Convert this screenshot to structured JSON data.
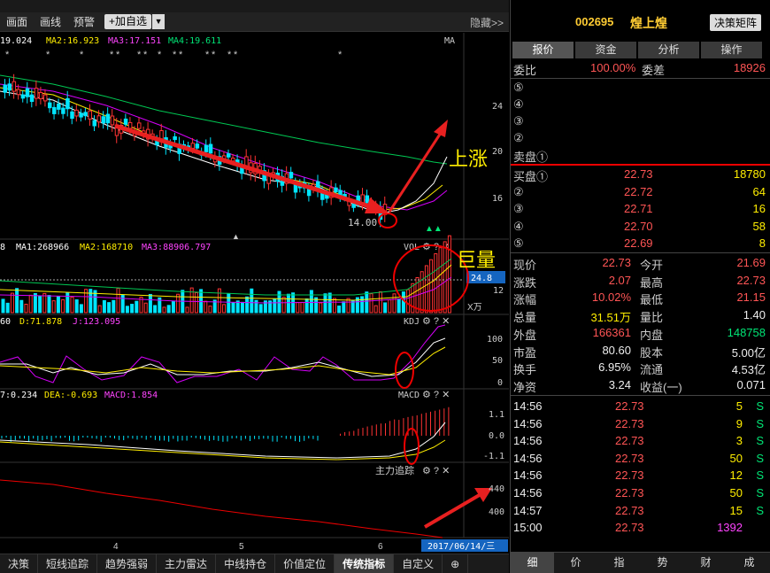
{
  "topbar": {
    "items": [
      "…",
      "…",
      "…",
      "…"
    ]
  },
  "toolbar": {
    "items": [
      "画面",
      "画线",
      "预警"
    ],
    "add_label": "+加自选",
    "hide_label": "隐藏>>"
  },
  "ma_legend": {
    "ma1": "19.024",
    "ma2": "MA2:16.923",
    "ma3": "MA3:17.151",
    "ma4": "MA4:19.611",
    "tag": "MA"
  },
  "vol_legend": {
    "prefix": "8",
    "ma1": "MA1:268966",
    "ma2": "MA2:168710",
    "ma3": "MA3:88906.797",
    "tag": "VOL"
  },
  "kdj_legend": {
    "prefix": "60",
    "d": "D:71.878",
    "j": "J:123.095",
    "tag": "KDJ"
  },
  "macd_legend": {
    "dif": "7:0.234",
    "dea": "DEA:-0.693",
    "macd": "MACD:1.854",
    "tag": "MACD"
  },
  "zljz_tag": "主力追踪",
  "axis": {
    "price": [
      "24",
      "20",
      "16"
    ],
    "vol": [
      "24.8",
      "12",
      "X万"
    ],
    "kdj": [
      "100",
      "50",
      "0"
    ],
    "macd": [
      "1.1",
      "0.0",
      "-1.1"
    ],
    "zljz": [
      "440",
      "400"
    ],
    "months": [
      "4",
      "5",
      "6"
    ],
    "date_label": "2017/06/14/三",
    "low_label": "14.00"
  },
  "annotations": {
    "up": "上涨",
    "vol": "巨量"
  },
  "bottom_tabs": [
    "决策",
    "短线追踪",
    "趋势强弱",
    "主力雷达",
    "中线持仓",
    "价值定位",
    "传统指标",
    "自定义"
  ],
  "active_tab": "传统指标",
  "stock": {
    "code": "002695",
    "name": "煌上煌",
    "matrix_btn": "决策矩阵"
  },
  "rtabs": [
    "报价",
    "资金",
    "分析",
    "操作"
  ],
  "quote": {
    "webi_label": "委比",
    "webi_val": "100.00%",
    "wecha_label": "委差",
    "wecha_val": "18926",
    "sell_levels": [
      "⑤",
      "④",
      "③",
      "②",
      "卖盘①"
    ],
    "buy": [
      {
        "lvl": "买盘①",
        "price": "22.73",
        "vol": "18780"
      },
      {
        "lvl": "②",
        "price": "22.72",
        "vol": "64"
      },
      {
        "lvl": "③",
        "price": "22.71",
        "vol": "16"
      },
      {
        "lvl": "④",
        "price": "22.70",
        "vol": "58"
      },
      {
        "lvl": "⑤",
        "price": "22.69",
        "vol": "8"
      }
    ],
    "stats": [
      {
        "l1": "现价",
        "v1": "22.73",
        "c1": "red",
        "l2": "今开",
        "v2": "21.69",
        "c2": "red"
      },
      {
        "l1": "涨跌",
        "v1": "2.07",
        "c1": "red",
        "l2": "最高",
        "v2": "22.73",
        "c2": "red"
      },
      {
        "l1": "涨幅",
        "v1": "10.02%",
        "c1": "red",
        "l2": "最低",
        "v2": "21.15",
        "c2": "red"
      },
      {
        "l1": "总量",
        "v1": "31.51万",
        "c1": "yellow",
        "l2": "量比",
        "v2": "1.40",
        "c2": "white"
      },
      {
        "l1": "外盘",
        "v1": "166361",
        "c1": "red",
        "l2": "内盘",
        "v2": "148758",
        "c2": "green"
      },
      {
        "l1": "市盈",
        "v1": "80.60",
        "c1": "white",
        "l2": "股本",
        "v2": "5.00亿",
        "c2": "white"
      },
      {
        "l1": "换手",
        "v1": "6.95%",
        "c1": "white",
        "l2": "流通",
        "v2": "4.53亿",
        "c2": "white"
      },
      {
        "l1": "净资",
        "v1": "3.24",
        "c1": "white",
        "l2": "收益(一)",
        "v2": "0.071",
        "c2": "white"
      }
    ],
    "ticks": [
      {
        "t": "14:56",
        "p": "22.73",
        "v": "5",
        "s": "S"
      },
      {
        "t": "14:56",
        "p": "22.73",
        "v": "9",
        "s": "S"
      },
      {
        "t": "14:56",
        "p": "22.73",
        "v": "3",
        "s": "S"
      },
      {
        "t": "14:56",
        "p": "22.73",
        "v": "50",
        "s": "S"
      },
      {
        "t": "14:56",
        "p": "22.73",
        "v": "12",
        "s": "S"
      },
      {
        "t": "14:56",
        "p": "22.73",
        "v": "50",
        "s": "S"
      },
      {
        "t": "14:57",
        "p": "22.73",
        "v": "15",
        "s": "S"
      },
      {
        "t": "15:00",
        "p": "22.73",
        "v": "1392",
        "s": ""
      }
    ]
  },
  "rbottom": [
    "细",
    "价",
    "指",
    "势",
    "财",
    "成"
  ]
}
